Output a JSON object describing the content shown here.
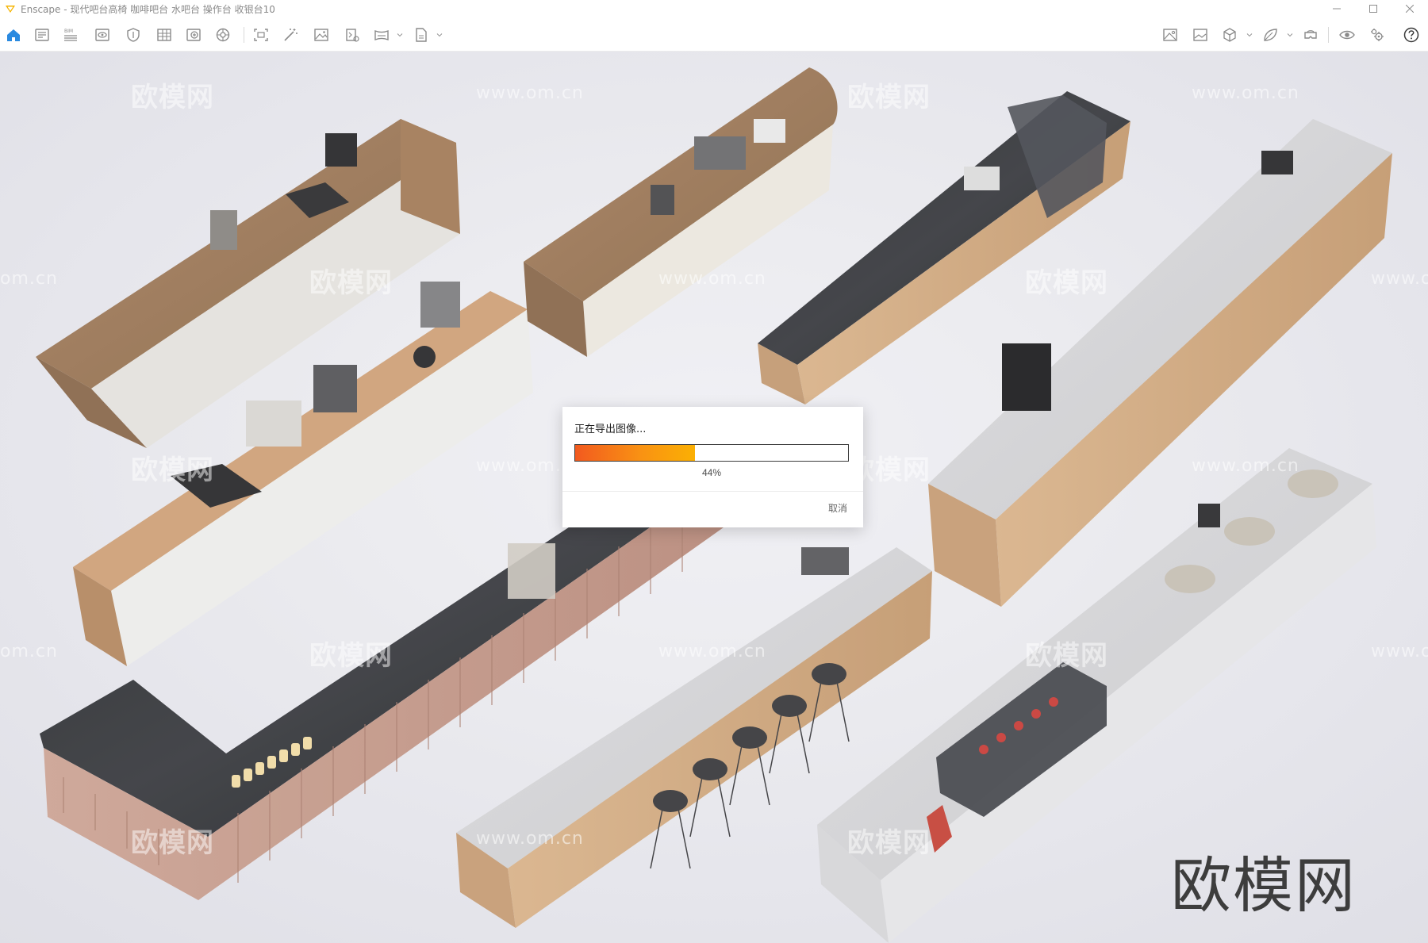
{
  "window": {
    "app_name": "Enscape",
    "title": "Enscape - 现代吧台高椅 咖啡吧台 水吧台 操作台 收银台10",
    "controls": [
      "minimize-icon",
      "maximize-icon",
      "close-icon"
    ]
  },
  "toolbar": {
    "left_icons": [
      "home-icon",
      "document-settings-icon",
      "bim-icon",
      "view-icon",
      "shield-icon",
      "grid-icon",
      "add-view-icon",
      "asset-library-icon",
      "screenshot-icon",
      "magic-wand-icon",
      "image-export-icon",
      "batch-export-icon",
      "panorama-export-icon",
      "export-file-icon"
    ],
    "right_icons": [
      "material-editor-icon",
      "image-icon",
      "cube-icon",
      "leaf-icon",
      "vr-headset-icon",
      "eye-settings-icon",
      "gears-icon",
      "help-icon"
    ],
    "accent_color": "#2a8ae0"
  },
  "viewport": {
    "watermarks": {
      "cn": "欧模网",
      "url": "www.om.cn",
      "edge": "om.cn",
      "edge_right": "www.o"
    },
    "logo": "欧模网"
  },
  "export_dialog": {
    "title": "正在导出图像...",
    "progress_percent": 44,
    "progress_label": "44%",
    "cancel_label": "取消"
  }
}
